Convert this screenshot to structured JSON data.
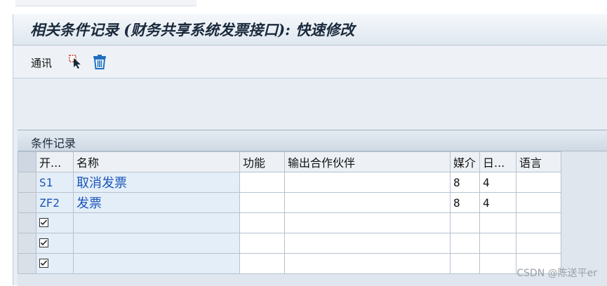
{
  "window": {
    "title": "相关条件记录 (财务共享系统发票接口): 快速修改"
  },
  "toolbar": {
    "communicate_label": "通讯",
    "icons": [
      "select-icon",
      "trash-icon"
    ]
  },
  "panel": {
    "title": "条件记录"
  },
  "table": {
    "columns": [
      "开...",
      "名称",
      "功能",
      "输出合作伙伴",
      "媒介",
      "日...",
      "语言"
    ],
    "rows": [
      {
        "key": "S1",
        "name": "取消发票",
        "function": "",
        "partner": "",
        "medium": "8",
        "date": "4",
        "language": ""
      },
      {
        "key": "ZF2",
        "name": "发票",
        "function": "",
        "partner": "",
        "medium": "8",
        "date": "4",
        "language": ""
      },
      {
        "key": "",
        "name": "",
        "function": "",
        "partner": "",
        "medium": "",
        "date": "",
        "language": "",
        "checkbox": true
      },
      {
        "key": "",
        "name": "",
        "function": "",
        "partner": "",
        "medium": "",
        "date": "",
        "language": "",
        "checkbox": true
      },
      {
        "key": "",
        "name": "",
        "function": "",
        "partner": "",
        "medium": "",
        "date": "",
        "language": "",
        "checkbox": true
      }
    ]
  },
  "watermark": "CSDN @陈送平er",
  "colors": {
    "key_text": "#1a55b8",
    "frame_bg": "#e8eef4"
  }
}
